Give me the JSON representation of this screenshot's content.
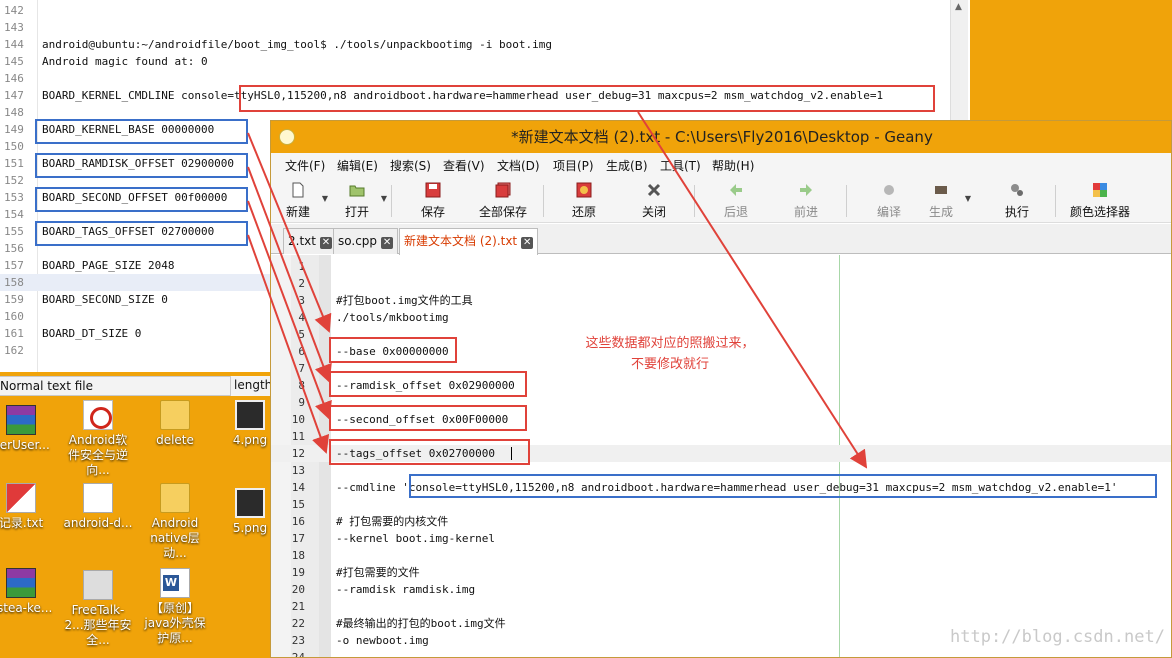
{
  "background_editor": {
    "lines": [
      {
        "num": "142",
        "text": ""
      },
      {
        "num": "143",
        "text": ""
      },
      {
        "num": "144",
        "text": "android@ubuntu:~/androidfile/boot_img_tool$ ./tools/unpackbootimg -i boot.img"
      },
      {
        "num": "145",
        "text": "Android magic found at: 0"
      },
      {
        "num": "146",
        "text": ""
      },
      {
        "num": "147",
        "text": "BOARD_KERNEL_CMDLINE console=ttyHSL0,115200,n8 androidboot.hardware=hammerhead user_debug=31 maxcpus=2 msm_watchdog_v2.enable=1"
      },
      {
        "num": "148",
        "text": ""
      },
      {
        "num": "149",
        "text": "BOARD_KERNEL_BASE 00000000"
      },
      {
        "num": "150",
        "text": ""
      },
      {
        "num": "151",
        "text": "BOARD_RAMDISK_OFFSET 02900000"
      },
      {
        "num": "152",
        "text": ""
      },
      {
        "num": "153",
        "text": "BOARD_SECOND_OFFSET 00f00000"
      },
      {
        "num": "154",
        "text": ""
      },
      {
        "num": "155",
        "text": "BOARD_TAGS_OFFSET 02700000"
      },
      {
        "num": "156",
        "text": ""
      },
      {
        "num": "157",
        "text": "BOARD_PAGE_SIZE 2048"
      },
      {
        "num": "158",
        "text": ""
      },
      {
        "num": "159",
        "text": "BOARD_SECOND_SIZE 0"
      },
      {
        "num": "160",
        "text": ""
      },
      {
        "num": "161",
        "text": "BOARD_DT_SIZE 0"
      },
      {
        "num": "162",
        "text": ""
      }
    ],
    "status_filetype": "Normal text file",
    "status_length": "length"
  },
  "desktop": {
    "icons": [
      {
        "label": "perUser...",
        "glyph": "winrar-icon"
      },
      {
        "label": "Android软件安全与逆向...",
        "glyph": "pdf-icon"
      },
      {
        "label": "delete",
        "glyph": "folder-icon"
      },
      {
        "label": "4.png",
        "glyph": "image-icon"
      },
      {
        "label": "记录.txt",
        "glyph": "text-edit-icon"
      },
      {
        "label": "android-d...",
        "glyph": "document-icon"
      },
      {
        "label": "Android native层动...",
        "glyph": "folder-icon"
      },
      {
        "label": "5.png",
        "glyph": "image-icon"
      },
      {
        "label": "ostea-ke...",
        "glyph": "winrar-icon"
      },
      {
        "label": "FreeTalk-2...那些年安全...",
        "glyph": "document-icon"
      },
      {
        "label": "【原创】java外壳保护原...",
        "glyph": "word-icon"
      }
    ]
  },
  "geany": {
    "title": "*新建文本文档 (2).txt - C:\\Users\\Fly2016\\Desktop - Geany",
    "menu": [
      "文件(F)",
      "编辑(E)",
      "搜索(S)",
      "查看(V)",
      "文档(D)",
      "项目(P)",
      "生成(B)",
      "工具(T)",
      "帮助(H)"
    ],
    "toolbar": {
      "new": "新建",
      "open": "打开",
      "save": "保存",
      "save_all": "全部保存",
      "revert": "还原",
      "close": "关闭",
      "back": "后退",
      "forward": "前进",
      "compile": "编译",
      "build": "生成",
      "execute": "执行",
      "color_chooser": "颜色选择器"
    },
    "tabs": [
      "2.txt",
      "so.cpp",
      "新建文本文档 (2).txt"
    ],
    "lines": [
      {
        "num": "1",
        "text": ""
      },
      {
        "num": "2",
        "text": ""
      },
      {
        "num": "3",
        "text": "#打包boot.img文件的工具"
      },
      {
        "num": "4",
        "text": "./tools/mkbootimg"
      },
      {
        "num": "5",
        "text": ""
      },
      {
        "num": "6",
        "text": "--base 0x00000000"
      },
      {
        "num": "7",
        "text": ""
      },
      {
        "num": "8",
        "text": "--ramdisk_offset 0x02900000"
      },
      {
        "num": "9",
        "text": ""
      },
      {
        "num": "10",
        "text": "--second_offset 0x00F00000"
      },
      {
        "num": "11",
        "text": ""
      },
      {
        "num": "12",
        "text": "--tags_offset 0x02700000"
      },
      {
        "num": "13",
        "text": ""
      },
      {
        "num": "14",
        "text": "--cmdline 'console=ttyHSL0,115200,n8 androidboot.hardware=hammerhead user_debug=31 maxcpus=2 msm_watchdog_v2.enable=1'"
      },
      {
        "num": "15",
        "text": ""
      },
      {
        "num": "16",
        "text": "# 打包需要的内核文件"
      },
      {
        "num": "17",
        "text": "--kernel boot.img-kernel"
      },
      {
        "num": "18",
        "text": ""
      },
      {
        "num": "19",
        "text": "#打包需要的文件"
      },
      {
        "num": "20",
        "text": "--ramdisk ramdisk.img"
      },
      {
        "num": "21",
        "text": ""
      },
      {
        "num": "22",
        "text": "#最终输出的打包的boot.img文件"
      },
      {
        "num": "23",
        "text": "-o newboot.img"
      },
      {
        "num": "24",
        "text": ""
      }
    ]
  },
  "annotation": {
    "note_line1": "这些数据都对应的照搬过来，",
    "note_line2": "不要修改就行",
    "color_red": "#e0423a",
    "color_blue": "#3a6fc9"
  },
  "watermark": "http://blog.csdn.net/"
}
